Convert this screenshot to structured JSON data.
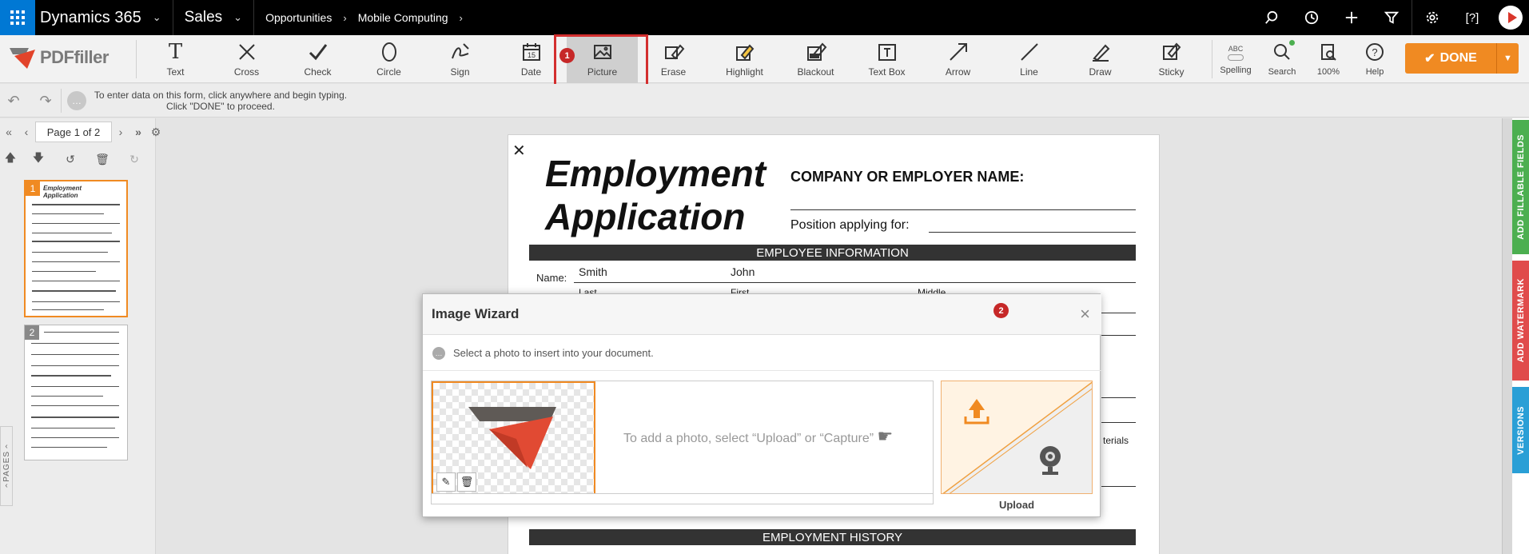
{
  "topnav": {
    "app_name": "Dynamics 365",
    "area": "Sales",
    "breadcrumb": [
      "Opportunities",
      "Mobile Computing"
    ]
  },
  "toolbar": {
    "logo_text": "PDFfiller",
    "tools": [
      {
        "label": "Text",
        "icon": "text-icon"
      },
      {
        "label": "Cross",
        "icon": "cross-icon"
      },
      {
        "label": "Check",
        "icon": "check-icon"
      },
      {
        "label": "Circle",
        "icon": "circle-icon"
      },
      {
        "label": "Sign",
        "icon": "sign-icon"
      },
      {
        "label": "Date",
        "icon": "date-icon"
      },
      {
        "label": "Picture",
        "icon": "picture-icon"
      },
      {
        "label": "Erase",
        "icon": "erase-icon"
      },
      {
        "label": "Highlight",
        "icon": "highlight-icon"
      },
      {
        "label": "Blackout",
        "icon": "blackout-icon"
      },
      {
        "label": "Text Box",
        "icon": "text-box-icon"
      },
      {
        "label": "Arrow",
        "icon": "arrow-icon"
      },
      {
        "label": "Line",
        "icon": "line-icon"
      },
      {
        "label": "Draw",
        "icon": "draw-icon"
      },
      {
        "label": "Sticky",
        "icon": "sticky-icon"
      }
    ],
    "right_tools": [
      {
        "label": "Spelling",
        "icon_text": "ABC"
      },
      {
        "label": "Search"
      },
      {
        "label": "100%"
      },
      {
        "label": "Help"
      }
    ],
    "done_label": "DONE",
    "date_icon_text": "15",
    "accent": "#f08a22"
  },
  "hint": {
    "line1": "To enter data on this form, click anywhere and begin typing.",
    "line2": "Click \"DONE\" to proceed."
  },
  "pager": {
    "page_word": "Page",
    "current": "1",
    "of_word": "of",
    "total": "2"
  },
  "thumbs": [
    "1",
    "2"
  ],
  "pages_tab": "PAGES",
  "badges": [
    "1",
    "2"
  ],
  "document": {
    "title_line1": "Employment",
    "title_line2": "Application",
    "company_label": "COMPANY OR EMPLOYER NAME:",
    "position_label": "Position applying for:",
    "section_employee": "EMPLOYEE INFORMATION",
    "name_label": "Name:",
    "last_value": "Smith",
    "first_value": "John",
    "last_label": "Last",
    "first_label": "First",
    "middle_label": "Middle",
    "partial_text": "terials",
    "section_history": "EMPLOYMENT HISTORY"
  },
  "sidetabs": [
    {
      "label": "ADD FILLABLE FIELDS",
      "color": "#4caf50"
    },
    {
      "label": "ADD WATERMARK",
      "color": "#e04b4b"
    },
    {
      "label": "VERSIONS",
      "color": "#2a9fd6"
    }
  ],
  "wizard": {
    "title": "Image Wizard",
    "hint": "Select a photo to insert into your document.",
    "add_photo_msg": "To add a photo, select “Upload” or “Capture”",
    "upload_label": "Upload"
  }
}
